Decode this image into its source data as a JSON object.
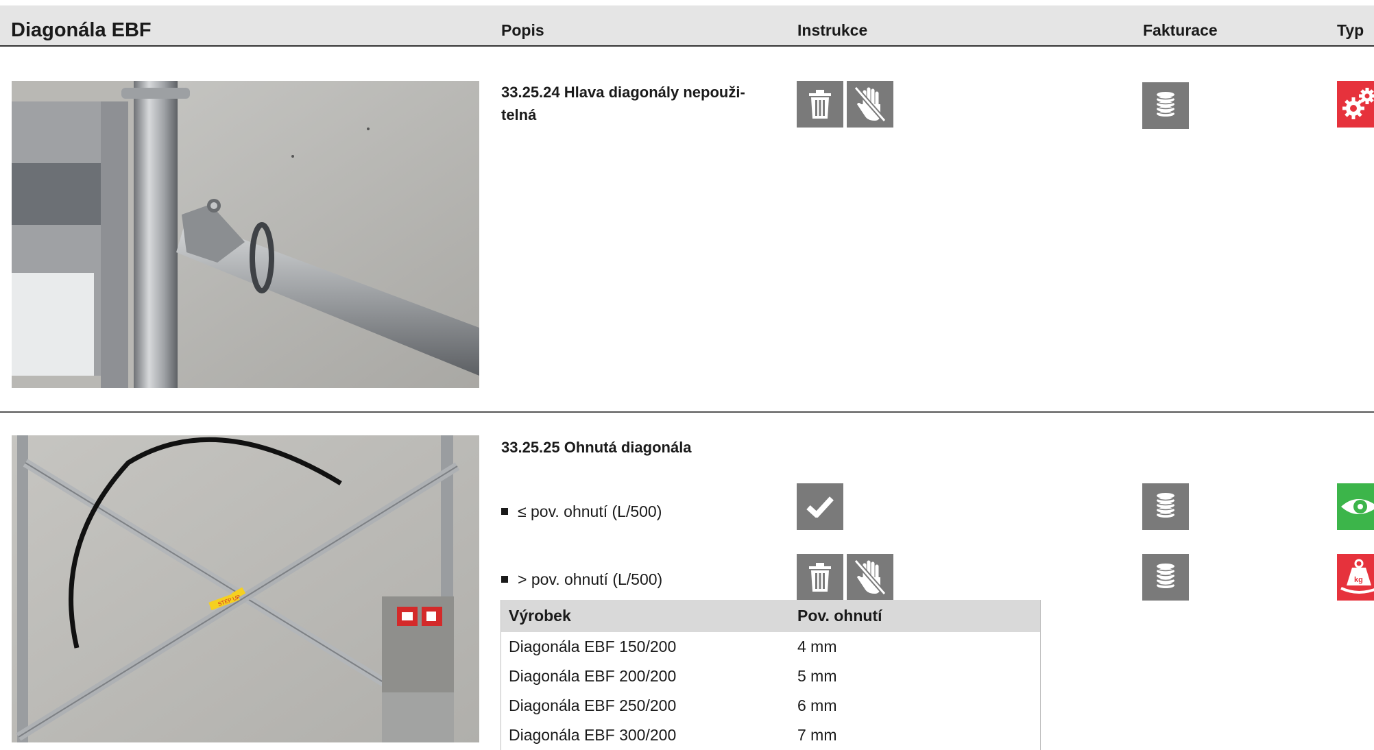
{
  "header": {
    "title": "Diagonála EBF",
    "col_popis": "Popis",
    "col_instrukce": "Instrukce",
    "col_fakturace": "Fakturace",
    "col_typ": "Typ"
  },
  "section1": {
    "title": "33.25.24 Hlava diagonály nepouži-telná",
    "title_line1": "33.25.24 Hlava diagonály nepouži-",
    "title_line2": "telná",
    "instructions": [
      "trash-icon",
      "no-hand-icon"
    ],
    "billing_icon": "coin-stack-icon",
    "type_icon": "gears-icon",
    "type_color": "#e6323c"
  },
  "section2": {
    "title": "33.25.25 Ohnutá diagonála",
    "photo_label": "STEP UP",
    "items": [
      {
        "text": "≤ pov. ohnutí (L/500)",
        "instructions": [
          "check-icon"
        ],
        "billing_icon": "coin-stack-icon",
        "type_icon": "eye-icon",
        "type_color": "#3cb54a"
      },
      {
        "text": "> pov. ohnutí (L/500)",
        "instructions": [
          "trash-icon",
          "no-hand-icon"
        ],
        "billing_icon": "coin-stack-icon",
        "type_icon": "weight-kg-icon",
        "type_label": "kg",
        "type_color": "#e6323c"
      }
    ],
    "table": {
      "headers": [
        "Výrobek",
        "Pov. ohnutí"
      ],
      "rows": [
        [
          "Diagonála EBF 150/200",
          "4 mm"
        ],
        [
          "Diagonála EBF 200/200",
          "5 mm"
        ],
        [
          "Diagonála EBF 250/200",
          "6 mm"
        ],
        [
          "Diagonála EBF 300/200",
          "7 mm"
        ]
      ]
    }
  },
  "colors": {
    "header_bg": "#e5e5e5",
    "icon_gray": "#7a7a7a",
    "red": "#e6323c",
    "green": "#3cb54a"
  }
}
